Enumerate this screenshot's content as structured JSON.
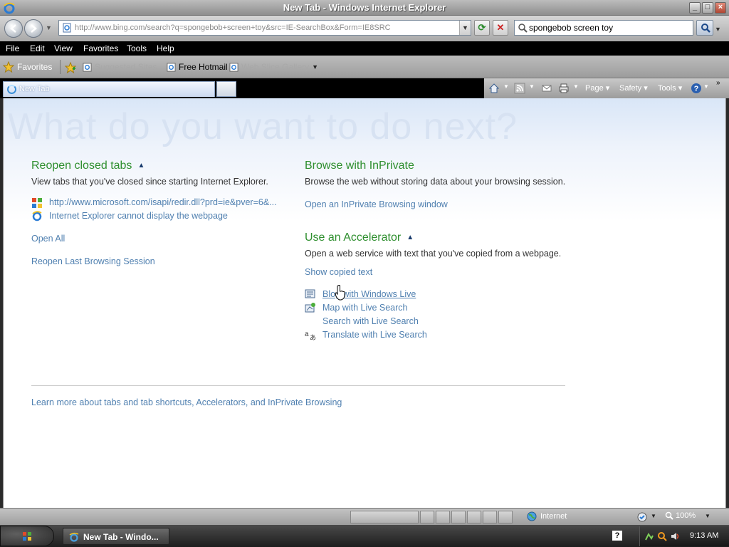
{
  "window": {
    "title": "New Tab - Windows Internet Explorer"
  },
  "address_bar": {
    "url": "http://www.bing.com/search?q=spongebob+screen+toy&src=IE-SearchBox&Form=IE8SRC"
  },
  "search_box": {
    "value": "spongebob screen toy"
  },
  "menu": {
    "items": [
      "File",
      "Edit",
      "View",
      "Favorites",
      "Tools",
      "Help"
    ]
  },
  "favorites_bar": {
    "favorites_label": "Favorites",
    "items": [
      {
        "label": "Suggested Sites",
        "dim": true
      },
      {
        "label": "Free Hotmail",
        "dim": false
      },
      {
        "label": "Web Slice Gallery",
        "dim": true
      }
    ]
  },
  "tabs": [
    {
      "label": "New Tab"
    }
  ],
  "command_bar": {
    "page": "Page",
    "safety": "Safety",
    "tools": "Tools"
  },
  "content": {
    "headline": "What do you want to do next?",
    "reopen": {
      "title": "Reopen closed tabs",
      "description": "View tabs that you've closed since starting Internet Explorer.",
      "closed_tabs": [
        {
          "label": "http://www.microsoft.com/isapi/redir.dll?prd=ie&pver=6&...",
          "icon": "windows-logo-icon"
        },
        {
          "label": "Internet Explorer cannot display the webpage",
          "icon": "ie-icon"
        }
      ],
      "open_all": "Open All",
      "reopen_last": "Reopen Last Browsing Session"
    },
    "inprivate": {
      "title": "Browse with InPrivate",
      "description": "Browse the web without storing data about your browsing session.",
      "link": "Open an InPrivate Browsing window"
    },
    "accelerator": {
      "title": "Use an Accelerator",
      "description": "Open a web service with text that you've copied from a webpage.",
      "show_copied": "Show copied text",
      "items": [
        {
          "label": "Blog with Windows Live",
          "icon": "blog-icon"
        },
        {
          "label": "Map with Live Search",
          "icon": "map-icon"
        },
        {
          "label": "Search with Live Search",
          "icon": ""
        },
        {
          "label": "Translate with Live Search",
          "icon": "translate-icon"
        }
      ]
    },
    "learn_more": "Learn more about tabs and tab shortcuts, Accelerators, and InPrivate Browsing"
  },
  "status_bar": {
    "zone": "Internet",
    "zoom": "100%"
  },
  "taskbar": {
    "task_label": "New Tab - Windo...",
    "clock": "9:13 AM"
  },
  "colors": {
    "heading_green": "#2f8f2f",
    "link_blue": "#5080b0",
    "headline_faint": "#d7e2f2"
  }
}
